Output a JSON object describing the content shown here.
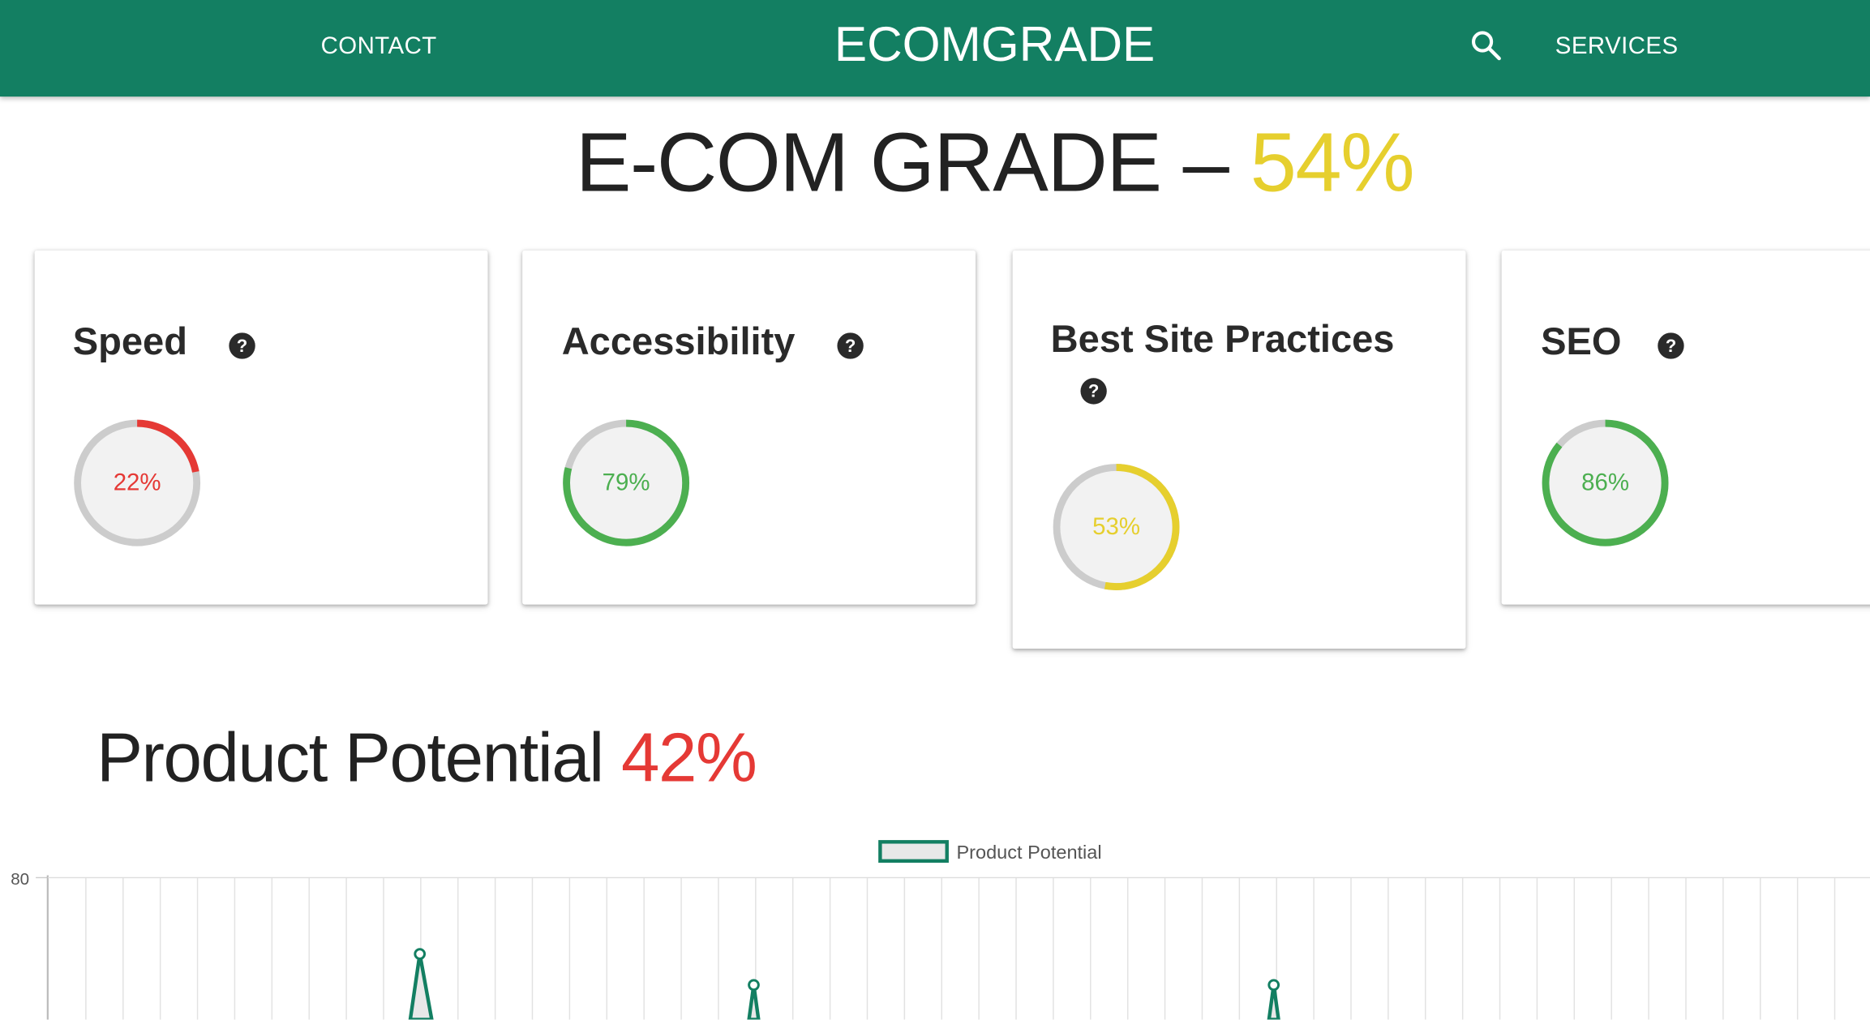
{
  "header": {
    "contact": "CONTACT",
    "brand": "ECOMGRADE",
    "services": "SERVICES"
  },
  "grade": {
    "label": "E-COM GRADE –",
    "value": "54%",
    "color": "#e6cf2e"
  },
  "cards": [
    {
      "title": "Speed",
      "value": "22%",
      "percent": 22,
      "color": "#e53935"
    },
    {
      "title": "Accessibility",
      "value": "79%",
      "percent": 79,
      "color": "#4caf50"
    },
    {
      "title": "Best Site Practices",
      "value": "53%",
      "percent": 53,
      "color": "#e6cf2e"
    },
    {
      "title": "SEO",
      "value": "86%",
      "percent": 86,
      "color": "#4caf50"
    }
  ],
  "product_potential": {
    "label": "Product Potential",
    "value": "42%",
    "color": "#e53935"
  },
  "chart_data": {
    "type": "line",
    "legend": [
      "Product Potential"
    ],
    "y_ticks": [
      "80"
    ],
    "series": [
      {
        "name": "Product Potential",
        "color": "#137f62"
      }
    ]
  }
}
